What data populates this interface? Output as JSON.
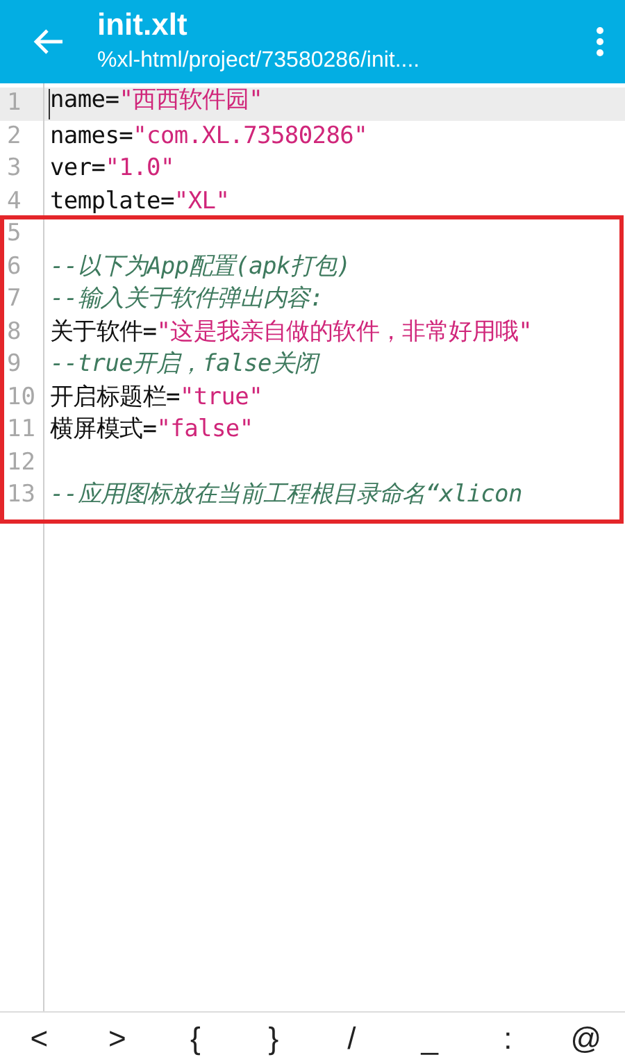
{
  "app_bar": {
    "title": "init.xlt",
    "subtitle": "%xl-html/project/73580286/init...."
  },
  "editor": {
    "lines": [
      {
        "number": "1",
        "current": true,
        "segments": [
          {
            "kind": "plain",
            "text": "name="
          },
          {
            "kind": "string",
            "text": "\"西西软件园\""
          }
        ]
      },
      {
        "number": "2",
        "current": false,
        "segments": [
          {
            "kind": "plain",
            "text": "names="
          },
          {
            "kind": "string",
            "text": "\"com.XL.73580286\""
          }
        ]
      },
      {
        "number": "3",
        "current": false,
        "segments": [
          {
            "kind": "plain",
            "text": "ver="
          },
          {
            "kind": "string",
            "text": "\"1.0\""
          }
        ]
      },
      {
        "number": "4",
        "current": false,
        "segments": [
          {
            "kind": "plain",
            "text": "template="
          },
          {
            "kind": "string",
            "text": "\"XL\""
          }
        ]
      },
      {
        "number": "5",
        "current": false
      },
      {
        "number": "6",
        "current": false,
        "segments": [
          {
            "kind": "comment",
            "text": "--以下为App配置(apk打包)"
          }
        ]
      },
      {
        "number": "7",
        "current": false,
        "segments": [
          {
            "kind": "comment",
            "text": "--输入关于软件弹出内容:"
          }
        ]
      },
      {
        "number": "8",
        "current": false,
        "segments": [
          {
            "kind": "plain",
            "text": "关于软件="
          },
          {
            "kind": "string",
            "text": "\"这是我亲自做的软件，非常好用哦\""
          }
        ]
      },
      {
        "number": "9",
        "current": false,
        "segments": [
          {
            "kind": "comment",
            "text": "--true开启，false关闭"
          }
        ]
      },
      {
        "number": "10",
        "current": false,
        "segments": [
          {
            "kind": "plain",
            "text": "开启标题栏="
          },
          {
            "kind": "string",
            "text": "\"true\""
          }
        ]
      },
      {
        "number": "11",
        "current": false,
        "segments": [
          {
            "kind": "plain",
            "text": "横屏模式="
          },
          {
            "kind": "string",
            "text": "\"false\""
          }
        ]
      },
      {
        "number": "12",
        "current": false
      },
      {
        "number": "13",
        "current": false,
        "segments": [
          {
            "kind": "comment",
            "text": "--应用图标放在当前工程根目录命名“xlicon"
          }
        ]
      }
    ],
    "highlight_box": {
      "shown": true
    }
  },
  "symbol_bar": {
    "keys": [
      "<",
      ">",
      "{",
      "}",
      "/",
      "_",
      ":",
      "@"
    ]
  }
}
